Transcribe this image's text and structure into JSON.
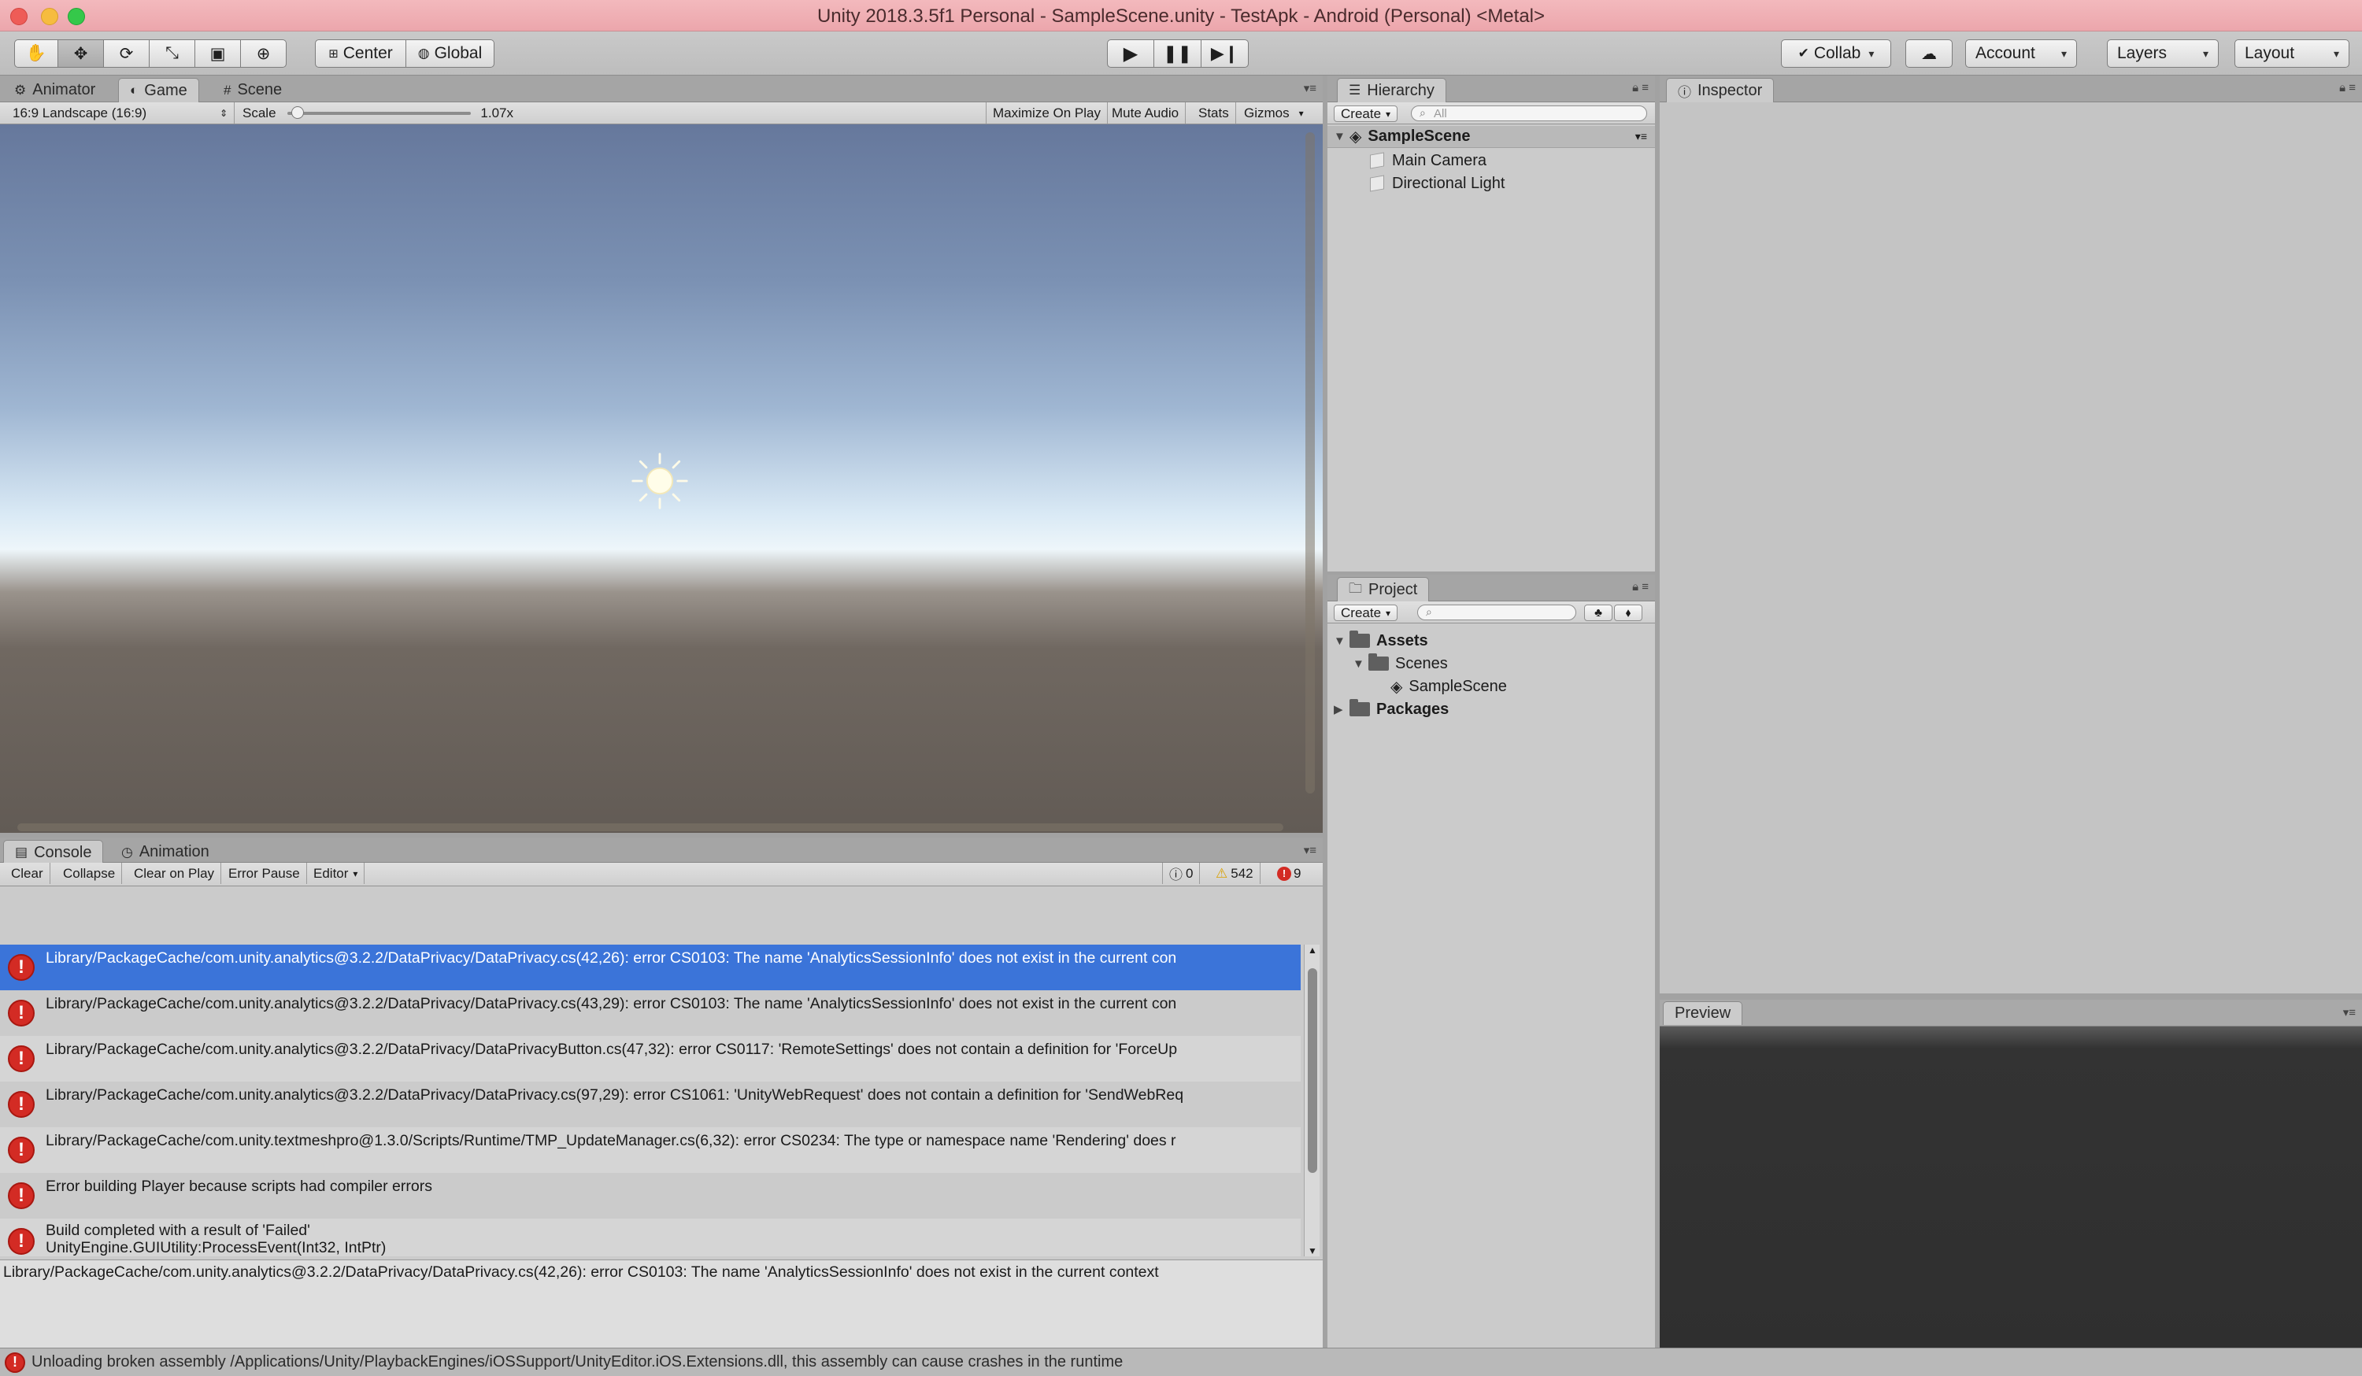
{
  "window": {
    "title": "Unity 2018.3.5f1 Personal - SampleScene.unity - TestApk - Android (Personal) <Metal>"
  },
  "toolbar": {
    "tools": [
      "hand-tool",
      "move-tool",
      "rotate-tool",
      "scale-tool",
      "rect-tool",
      "transform-tool"
    ],
    "pivot_label": "Center",
    "space_label": "Global",
    "collab_label": "Collab",
    "account_label": "Account",
    "layers_label": "Layers",
    "layout_label": "Layout"
  },
  "game_panel": {
    "tabs": [
      {
        "label": "Animator",
        "icon": "animator-icon"
      },
      {
        "label": "Game",
        "icon": "game-icon",
        "active": true
      },
      {
        "label": "Scene",
        "icon": "scene-grid-icon"
      }
    ],
    "aspect": "16:9 Landscape (16:9)",
    "scale_label": "Scale",
    "scale_value": "1.07x",
    "scale_fraction": 0.02,
    "maximize_label": "Maximize On Play",
    "mute_label": "Mute Audio",
    "stats_label": "Stats",
    "gizmos_label": "Gizmos"
  },
  "hierarchy": {
    "tab_label": "Hierarchy",
    "create_label": "Create",
    "search_placeholder": "All",
    "scene_name": "SampleScene",
    "items": [
      "Main Camera",
      "Directional Light"
    ]
  },
  "project": {
    "tab_label": "Project",
    "create_label": "Create",
    "tree": {
      "assets": "Assets",
      "scenes": "Scenes",
      "sample_scene": "SampleScene",
      "packages": "Packages"
    }
  },
  "inspector": {
    "tab_label": "Inspector",
    "preview_label": "Preview"
  },
  "console": {
    "tabs": [
      {
        "label": "Console",
        "icon": "console-icon",
        "active": true
      },
      {
        "label": "Animation",
        "icon": "clock-icon"
      }
    ],
    "buttons": {
      "clear": "Clear",
      "collapse": "Collapse",
      "clear_on_play": "Clear on Play",
      "error_pause": "Error Pause",
      "editor": "Editor"
    },
    "counts": {
      "info": "0",
      "warnings": "542",
      "errors": "9"
    },
    "entries": [
      {
        "line1": "Library/PackageCache/com.unity.analytics@3.2.2/DataPrivacy/DataPrivacy.cs(42,26): error CS0103: The name 'AnalyticsSessionInfo' does not exist in the current con",
        "line2": "",
        "selected": true
      },
      {
        "line1": "Library/PackageCache/com.unity.analytics@3.2.2/DataPrivacy/DataPrivacy.cs(43,29): error CS0103: The name 'AnalyticsSessionInfo' does not exist in the current con",
        "line2": "",
        "selected": false
      },
      {
        "line1": "Library/PackageCache/com.unity.analytics@3.2.2/DataPrivacy/DataPrivacyButton.cs(47,32): error CS0117: 'RemoteSettings' does not contain a definition for 'ForceUp",
        "line2": "",
        "selected": false
      },
      {
        "line1": "Library/PackageCache/com.unity.analytics@3.2.2/DataPrivacy/DataPrivacy.cs(97,29): error CS1061: 'UnityWebRequest' does not contain a definition for 'SendWebReq",
        "line2": "",
        "selected": false
      },
      {
        "line1": "Library/PackageCache/com.unity.textmeshpro@1.3.0/Scripts/Runtime/TMP_UpdateManager.cs(6,32): error CS0234: The type or namespace name 'Rendering' does r",
        "line2": "",
        "selected": false
      },
      {
        "line1": "Error building Player because scripts had compiler errors",
        "line2": "",
        "selected": false
      },
      {
        "line1": "Build completed with a result of 'Failed'",
        "line2": "UnityEngine.GUIUtility:ProcessEvent(Int32, IntPtr)",
        "selected": false
      }
    ],
    "detail": "Library/PackageCache/com.unity.analytics@3.2.2/DataPrivacy/DataPrivacy.cs(42,26): error CS0103: The name 'AnalyticsSessionInfo' does not exist in the current context"
  },
  "status_bar": {
    "message": "Unloading broken assembly /Applications/Unity/PlaybackEngines/iOSSupport/UnityEditor.iOS.Extensions.dll, this assembly can cause crashes in the runtime"
  },
  "colors": {
    "title_bar": "#eca6ac",
    "selection": "#3b74d9",
    "error": "#d32b24"
  }
}
